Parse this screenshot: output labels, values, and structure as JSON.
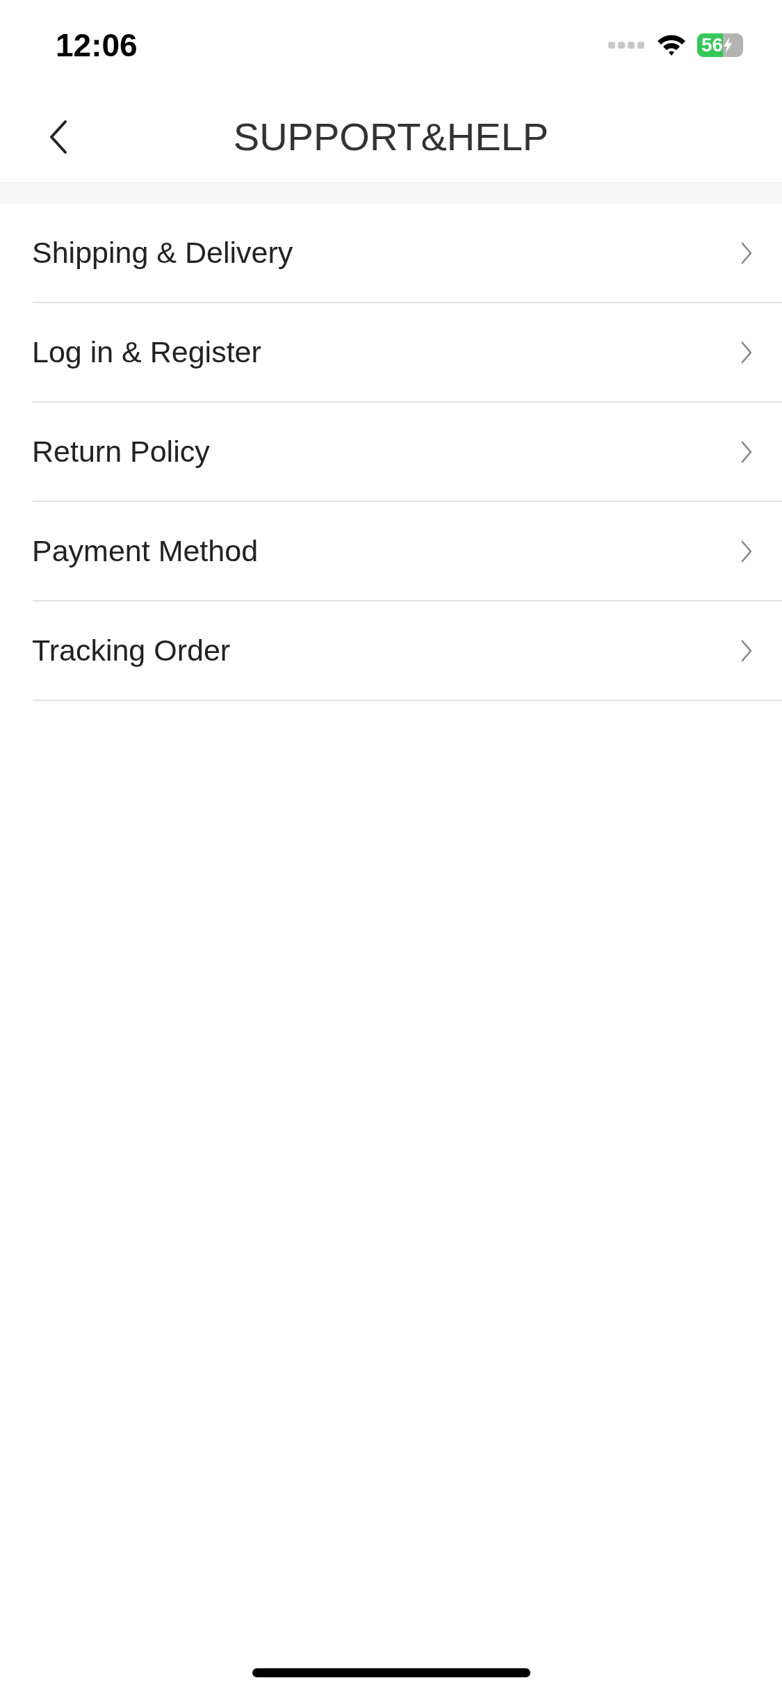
{
  "status_bar": {
    "time": "12:06",
    "battery": "56"
  },
  "nav_bar": {
    "title": "SUPPORT&HELP"
  },
  "menu_items": [
    {
      "label": "Shipping & Delivery"
    },
    {
      "label": "Log in & Register"
    },
    {
      "label": "Return Policy"
    },
    {
      "label": "Payment Method"
    },
    {
      "label": "Tracking Order"
    }
  ]
}
